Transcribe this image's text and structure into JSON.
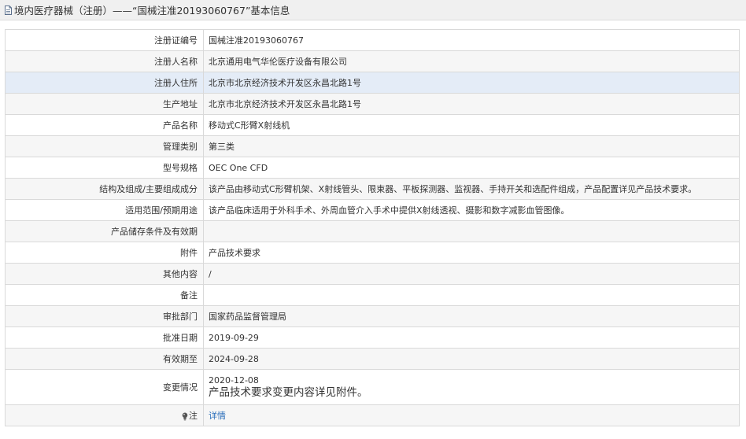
{
  "header": {
    "title": "境内医疗器械（注册）——“国械注准20193060767”基本信息"
  },
  "rows": [
    {
      "label": "注册证编号",
      "value": "国械注准20193060767"
    },
    {
      "label": "注册人名称",
      "value": "北京通用电气华伦医疗设备有限公司"
    },
    {
      "label": "注册人住所",
      "value": "北京市北京经济技术开发区永昌北路1号"
    },
    {
      "label": "生产地址",
      "value": "北京市北京经济技术开发区永昌北路1号"
    },
    {
      "label": "产品名称",
      "value": "移动式C形臂X射线机"
    },
    {
      "label": "管理类别",
      "value": "第三类"
    },
    {
      "label": "型号规格",
      "value": "OEC One CFD"
    },
    {
      "label": "结构及组成/主要组成成分",
      "value": "该产品由移动式C形臂机架、X射线管头、限束器、平板探测器、监视器、手持开关和选配件组成，产品配置详见产品技术要求。"
    },
    {
      "label": "适用范围/预期用途",
      "value": "该产品临床适用于外科手术、外周血管介入手术中提供X射线透视、摄影和数字减影血管图像。"
    },
    {
      "label": "产品储存条件及有效期",
      "value": ""
    },
    {
      "label": "附件",
      "value": "产品技术要求"
    },
    {
      "label": "其他内容",
      "value": "/"
    },
    {
      "label": "备注",
      "value": ""
    },
    {
      "label": "审批部门",
      "value": "国家药品监督管理局"
    },
    {
      "label": "批准日期",
      "value": "2019-09-29"
    },
    {
      "label": "有效期至",
      "value": "2024-09-28"
    }
  ],
  "change": {
    "label": "变更情况",
    "date": "2020-12-08",
    "text": "产品技术要求变更内容详见附件。"
  },
  "note": {
    "icon": "lightbulb-icon",
    "label": "注",
    "link": "详情"
  },
  "colors": {
    "header_bg": "#f0f0f0",
    "highlight_row": "#e4ecf7",
    "alt_row": "#f6f6f6",
    "border": "#d9d9d9",
    "link": "#2a6ebb"
  }
}
